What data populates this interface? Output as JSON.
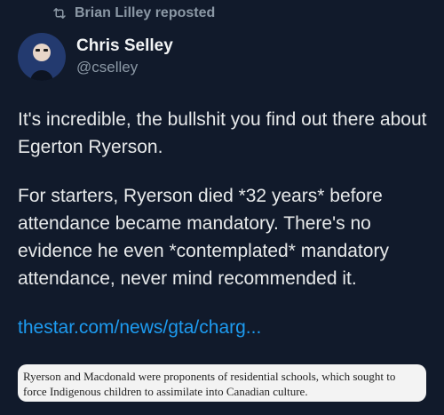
{
  "repost": {
    "label": "Brian Lilley reposted",
    "icon": "repost-icon"
  },
  "author": {
    "name": "Chris Selley",
    "handle": "@cselley"
  },
  "post": {
    "paragraphs": [
      "It's incredible, the bullshit you find out there about Egerton Ryerson.",
      "For starters, Ryerson died *32 years* before attendance became mandatory. There's no evidence he even *contemplated* mandatory attendance, never mind recommended it."
    ],
    "link": "thestar.com/news/gta/charg..."
  },
  "caption": {
    "text": "Ryerson and Macdonald were proponents of residential schools, which sought to force Indigenous children to assimilate into Canadian culture."
  },
  "colors": {
    "link": "#1d9bf0",
    "muted": "#8b98a5",
    "background": "#111a2b"
  }
}
